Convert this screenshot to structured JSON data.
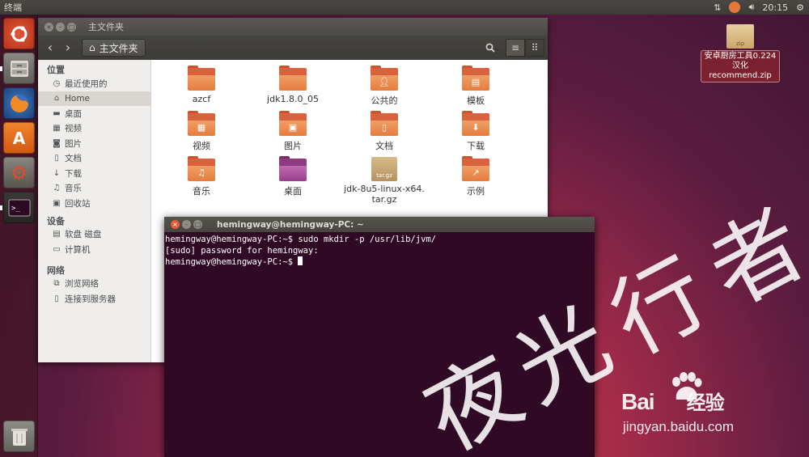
{
  "top_panel": {
    "title": "终端",
    "clock": "20:15"
  },
  "desktop": {
    "zip_icon_text": "zip",
    "zip_label": "安卓厨房工具0.224汉化 recommend.zip"
  },
  "file_manager": {
    "window_title": "主文件夹",
    "breadcrumb": "主文件夹",
    "sidebar": {
      "places_header": "位置",
      "places": [
        {
          "label": "最近使用的",
          "icon": "clock-icon"
        },
        {
          "label": "Home",
          "icon": "home-icon"
        },
        {
          "label": "桌面",
          "icon": "desktop-icon"
        },
        {
          "label": "视频",
          "icon": "video-icon"
        },
        {
          "label": "图片",
          "icon": "camera-icon"
        },
        {
          "label": "文档",
          "icon": "document-icon"
        },
        {
          "label": "下载",
          "icon": "download-icon"
        },
        {
          "label": "音乐",
          "icon": "music-icon"
        },
        {
          "label": "回收站",
          "icon": "trash-icon"
        }
      ],
      "devices_header": "设备",
      "devices": [
        {
          "label": "软盘 磁盘",
          "icon": "floppy-icon"
        },
        {
          "label": "计算机",
          "icon": "computer-icon"
        }
      ],
      "network_header": "网络",
      "network": [
        {
          "label": "浏览网络",
          "icon": "network-icon"
        },
        {
          "label": "连接到服务器",
          "icon": "server-icon"
        }
      ]
    },
    "items": [
      {
        "name": "azcf"
      },
      {
        "name": "jdk1.8.0_05"
      },
      {
        "name": "公共的"
      },
      {
        "name": "模板"
      },
      {
        "name": "视频"
      },
      {
        "name": "图片"
      },
      {
        "name": "文档"
      },
      {
        "name": "下载"
      },
      {
        "name": "音乐"
      },
      {
        "name": "桌面"
      },
      {
        "name": "jdk-8u5-linux-x64.tar.gz",
        "line1": "jdk-8u5-linux-x64.",
        "line2": "tar.gz",
        "badge": "tar.gz"
      },
      {
        "name": "示例"
      }
    ]
  },
  "terminal": {
    "window_title": "hemingway@hemingway-PC: ~",
    "lines": [
      "hemingway@hemingway-PC:~$ sudo mkdir -p /usr/lib/jvm/",
      "[sudo] password for hemingway:",
      "hemingway@hemingway-PC:~$ "
    ]
  },
  "watermark": {
    "chars": [
      "夜",
      "光",
      "行",
      "者"
    ],
    "brand": "Bai",
    "brand_cn": "经验",
    "url": "jingyan.baidu.com"
  },
  "colors": {
    "folder_orange": "#e67b3d",
    "terminal_bg": "#300a24",
    "panel_bg": "#3c3b37",
    "close_red": "#e35b3a"
  }
}
